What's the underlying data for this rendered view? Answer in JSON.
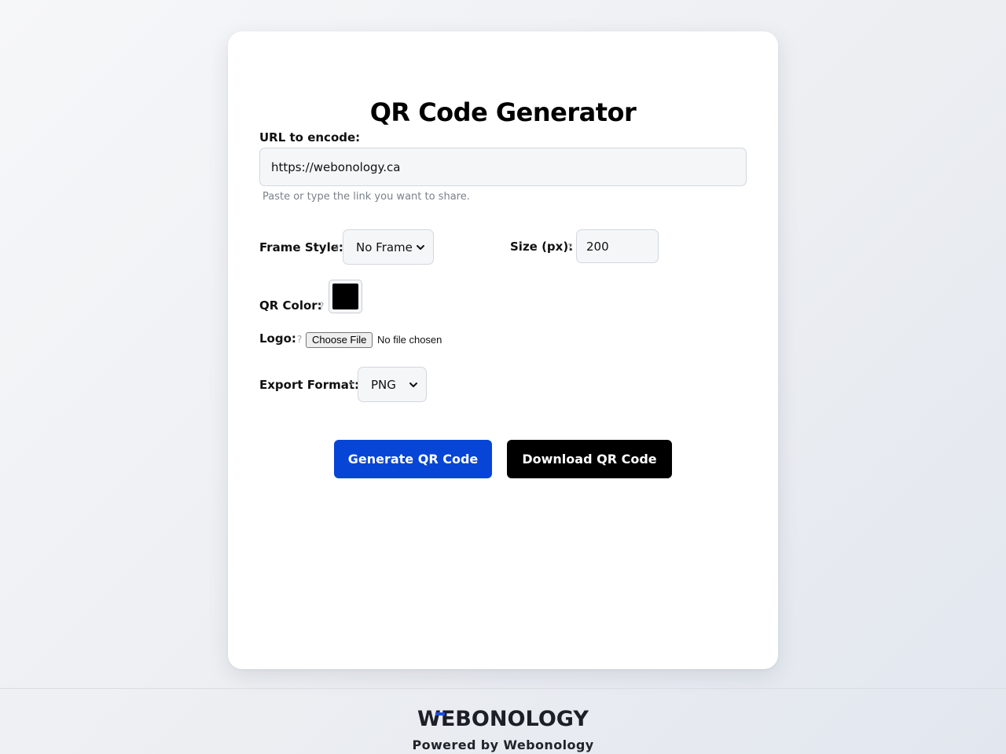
{
  "app": {
    "title": "QR Code Generator"
  },
  "form": {
    "url_label": "URL to encode:",
    "url_value": "https://webonology.ca",
    "url_hint": "Paste or type the link you want to share.",
    "help_glyph": "?",
    "frame_label": "Frame Style:",
    "frame_value": "No Frame",
    "size_label": "Size (px):",
    "size_value": "200",
    "color_label": "QR Color:",
    "color_value": "#000000",
    "logo_label": "Logo:",
    "logo_button": "Choose File",
    "logo_status": "No file chosen",
    "export_label": "Export Format:",
    "export_value": "PNG"
  },
  "actions": {
    "generate_label": "Generate QR Code",
    "download_label": "Download QR Code"
  },
  "footer": {
    "logo_text": "WEBONOLOGY",
    "powered_by": "Powered by Webonology"
  },
  "colors": {
    "primary": "#0645d6",
    "download": "#000000",
    "logo_accent": "#1a4fe0",
    "logo_text": "#1c2026"
  },
  "icons": {
    "dropdown": "chevron-down-icon",
    "help": "help-icon"
  }
}
